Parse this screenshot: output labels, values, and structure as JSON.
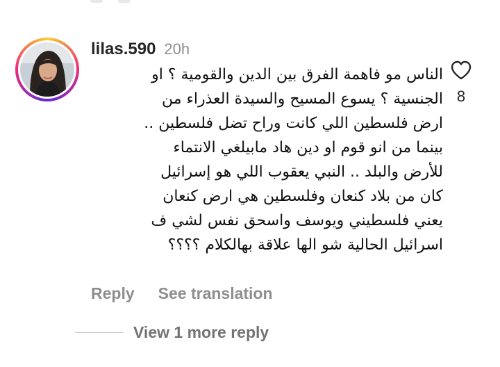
{
  "comment": {
    "username": "lilas.590",
    "timestamp": "20h",
    "lines": [
      "الناس مو فاهمة الفرق بين الدين والقومية ؟ او",
      "الجنسية ؟ يسوع المسيح والسيدة العذراء من",
      "ارض فلسطين اللي كانت وراح تضل فلسطين ..",
      "بينما من انو قوم او دين هاد مابيلغي الانتماء",
      "للأرض والبلد .. النبي يعقوب اللي هو إسرائيل",
      "كان من بلاد كنعان وفلسطين هي ارض كنعان",
      "يعني فلسطيني ويوسف واسحق نفس لشي ف",
      "اسرائيل الحالية شو الها علاقة بهالكلام ؟؟؟؟"
    ],
    "like_count": "8",
    "like_icon": "heart-outline-icon"
  },
  "actions": {
    "reply_label": "Reply",
    "translate_label": "See translation"
  },
  "replies": {
    "view_more_label": "View 1 more reply"
  },
  "colors": {
    "text": "#111111",
    "muted": "#8e8e8e",
    "username": "#262626"
  }
}
